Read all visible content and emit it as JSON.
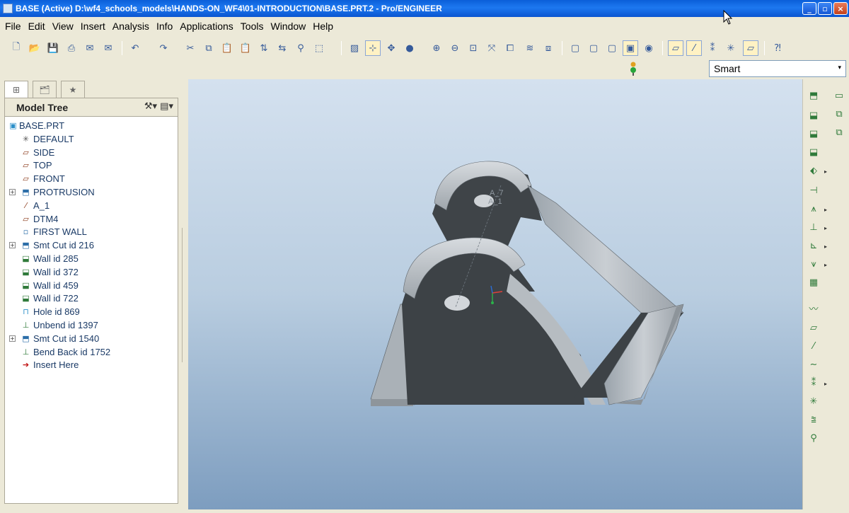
{
  "window": {
    "title": "BASE (Active) D:\\wf4_schools_models\\HANDS-ON_WF4\\01-INTRODUCTION\\BASE.PRT.2 - Pro/ENGINEER",
    "minimize": "_",
    "maximize": "▫",
    "close": "×"
  },
  "menu": [
    "File",
    "Edit",
    "View",
    "Insert",
    "Analysis",
    "Info",
    "Applications",
    "Tools",
    "Window",
    "Help"
  ],
  "filter": {
    "selected": "Smart",
    "arrow": "▾"
  },
  "model_tree": {
    "title": "Model Tree",
    "tools": "⚒▾ ▤▾",
    "items": [
      {
        "label": "BASE.PRT",
        "icon": "part-icon",
        "glyph": "▣",
        "expander": ""
      },
      {
        "label": "DEFAULT",
        "icon": "csys-icon",
        "glyph": "✳",
        "expander": ""
      },
      {
        "label": "SIDE",
        "icon": "datum-plane-icon",
        "glyph": "▱",
        "expander": ""
      },
      {
        "label": "TOP",
        "icon": "datum-plane-icon",
        "glyph": "▱",
        "expander": ""
      },
      {
        "label": "FRONT",
        "icon": "datum-plane-icon",
        "glyph": "▱",
        "expander": ""
      },
      {
        "label": "PROTRUSION",
        "icon": "protrusion-icon",
        "glyph": "⬒",
        "expander": "+"
      },
      {
        "label": "A_1",
        "icon": "datum-axis-icon",
        "glyph": "⁄",
        "expander": ""
      },
      {
        "label": "DTM4",
        "icon": "datum-plane-icon",
        "glyph": "▱",
        "expander": ""
      },
      {
        "label": "FIRST WALL",
        "icon": "wall-icon",
        "glyph": "▫",
        "expander": ""
      },
      {
        "label": "Smt Cut id 216",
        "icon": "cut-icon",
        "glyph": "⬒",
        "expander": "+"
      },
      {
        "label": "Wall id 285",
        "icon": "flange-wall-icon",
        "glyph": "⬓",
        "expander": ""
      },
      {
        "label": "Wall id 372",
        "icon": "flange-wall-icon",
        "glyph": "⬓",
        "expander": ""
      },
      {
        "label": "Wall id 459",
        "icon": "flange-wall-icon",
        "glyph": "⬓",
        "expander": ""
      },
      {
        "label": "Wall id 722",
        "icon": "flange-wall-icon",
        "glyph": "⬓",
        "expander": ""
      },
      {
        "label": "Hole id 869",
        "icon": "hole-icon",
        "glyph": "⊓",
        "expander": ""
      },
      {
        "label": "Unbend id 1397",
        "icon": "unbend-icon",
        "glyph": "⊥",
        "expander": ""
      },
      {
        "label": "Smt Cut id 1540",
        "icon": "cut-icon",
        "glyph": "⬒",
        "expander": "+"
      },
      {
        "label": "Bend Back id 1752",
        "icon": "bend-back-icon",
        "glyph": "⊥",
        "expander": ""
      },
      {
        "label": "Insert Here",
        "icon": "insert-arrow-icon",
        "glyph": "➔",
        "expander": ""
      }
    ]
  },
  "model": {
    "axis_label_1": "A_7",
    "axis_label_2": "A_1"
  },
  "colors": {
    "accent": "#0a5fd9",
    "highlight": "#fff2c4",
    "viewport_top": "#d4e1ef",
    "viewport_bottom": "#7d9dbf"
  }
}
